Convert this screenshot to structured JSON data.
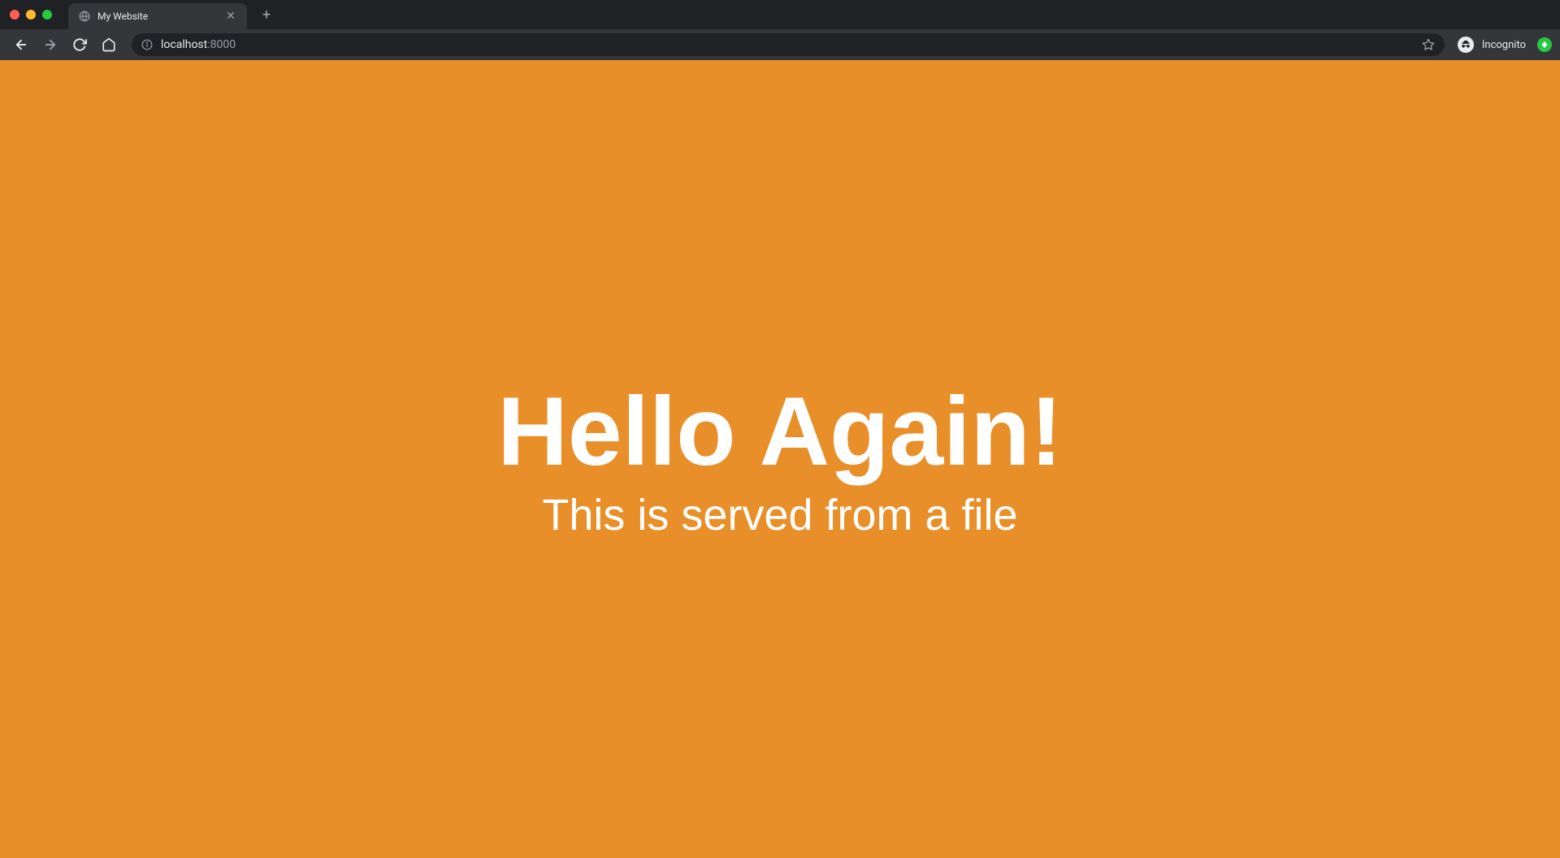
{
  "browser": {
    "tab": {
      "title": "My Website"
    },
    "address": {
      "host": "localhost",
      "port": ":8000"
    },
    "incognito_label": "Incognito"
  },
  "page": {
    "heading": "Hello Again!",
    "subheading": "This is served from a file"
  }
}
